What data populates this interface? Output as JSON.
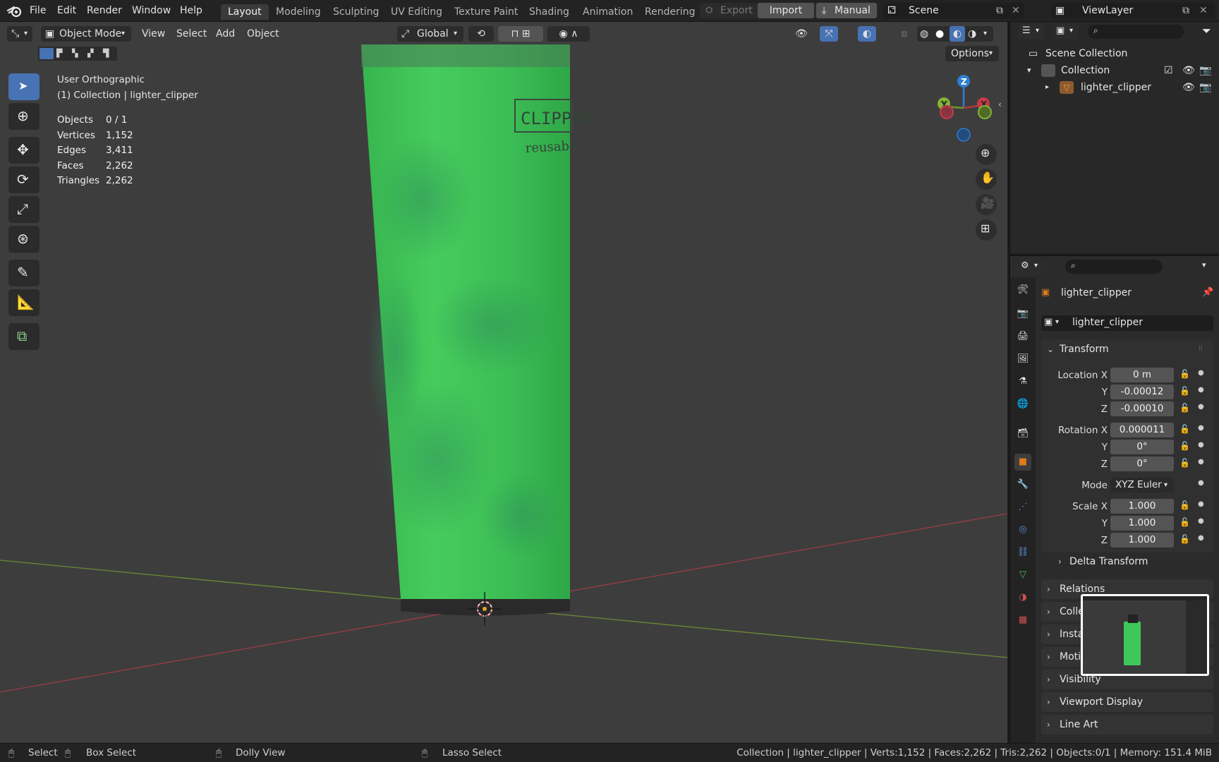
{
  "menus": [
    "File",
    "Edit",
    "Render",
    "Window",
    "Help"
  ],
  "workspaces": [
    "Layout",
    "Modeling",
    "Sculpting",
    "UV Editing",
    "Texture Paint",
    "Shading",
    "Animation",
    "Rendering"
  ],
  "topbar": {
    "export": "Export",
    "import": "Import",
    "manual": "Manual",
    "scene": "Scene",
    "view_layer": "ViewLayer"
  },
  "viewport_header": {
    "mode": "Object Mode",
    "menu": [
      "View",
      "Select",
      "Add",
      "Object"
    ],
    "orientation": "Global",
    "options": "Options"
  },
  "overlay": {
    "view_name": "User Orthographic",
    "context": "(1) Collection | lighter_clipper",
    "stats": [
      {
        "label": "Objects",
        "value": "0 / 1"
      },
      {
        "label": "Vertices",
        "value": "1,152"
      },
      {
        "label": "Edges",
        "value": "3,411"
      },
      {
        "label": "Faces",
        "value": "2,262"
      },
      {
        "label": "Triangles",
        "value": "2,262"
      }
    ]
  },
  "model": {
    "brand": "CLIPPER",
    "subtitle": "reusable"
  },
  "gizmo": {
    "x": "X",
    "y": "Y",
    "z": "Z"
  },
  "outliner": {
    "scene_collection": "Scene Collection",
    "collection": "Collection",
    "object": "lighter_clipper"
  },
  "properties": {
    "object_name": "lighter_clipper",
    "datablock": "lighter_clipper",
    "transform_title": "Transform",
    "location": {
      "label": "Location X",
      "x": "0 m",
      "y": "-0.00012",
      "z": "-0.00010"
    },
    "rotation": {
      "label": "Rotation X",
      "x": "0.000011",
      "y": "0°",
      "z": "0°"
    },
    "mode_label": "Mode",
    "mode_value": "XYZ Euler",
    "scale": {
      "label": "Scale X",
      "x": "1.000",
      "y": "1.000",
      "z": "1.000"
    },
    "axis_y": "Y",
    "axis_z": "Z",
    "delta": "Delta Transform",
    "panels": [
      "Relations",
      "Collections",
      "Instancing",
      "Motion Paths",
      "Visibility",
      "Viewport Display",
      "Line Art"
    ]
  },
  "statusbar": {
    "select": "Select",
    "box_select": "Box Select",
    "dolly": "Dolly View",
    "lasso": "Lasso Select",
    "info": "Collection | lighter_clipper | Verts:1,152 | Faces:2,262 | Tris:2,262 | Objects:0/1 | Memory: 151.4 MiB"
  },
  "colors": {
    "accent": "#4772b3",
    "active_tab": "#e07a1a",
    "x_axis": "#b0383f",
    "y_axis": "#6d9a2a",
    "z_axis": "#2e7fd1",
    "body": "#3fc85a"
  }
}
